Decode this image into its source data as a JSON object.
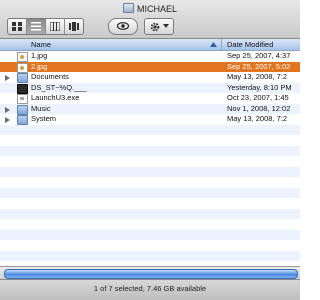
{
  "window": {
    "title": "MICHAEL"
  },
  "columns": {
    "name": "Name",
    "date": "Date Modified"
  },
  "rows": [
    {
      "name": "1.jpg",
      "date": "Sep 25, 2007, 4:37",
      "icon": "jpg-file-icon",
      "expandable": false,
      "state": "normal"
    },
    {
      "name": "2.jpg",
      "date": "Sep 25, 2007, 5:02",
      "icon": "jpg-file-icon",
      "expandable": false,
      "state": "selected"
    },
    {
      "name": "Documents",
      "date": "May 13, 2008, 7:2",
      "icon": "folder-icon",
      "expandable": true,
      "state": "normal"
    },
    {
      "name": "DS_ST~%Q.___",
      "date": "Yesterday, 8:10 PM",
      "icon": "dark-file-icon",
      "expandable": false,
      "state": "normal"
    },
    {
      "name": "LaunchU3.exe",
      "date": "Oct 23, 2007, 1:45",
      "icon": "exe-file-icon",
      "expandable": false,
      "state": "normal"
    },
    {
      "name": "Music",
      "date": "Nov 1, 2008, 12:02",
      "icon": "folder-icon",
      "expandable": true,
      "state": "normal"
    },
    {
      "name": "System",
      "date": "May 13, 2008, 7:2",
      "icon": "folder-icon",
      "expandable": true,
      "state": "normal"
    }
  ],
  "status": {
    "text": "1 of 7 selected, 7.46 GB available"
  },
  "colors": {
    "selection": "#e3751f",
    "stripe": "#edf3fe",
    "header": "#a6c2ea",
    "scroll_thumb": "#4a8ae2"
  }
}
